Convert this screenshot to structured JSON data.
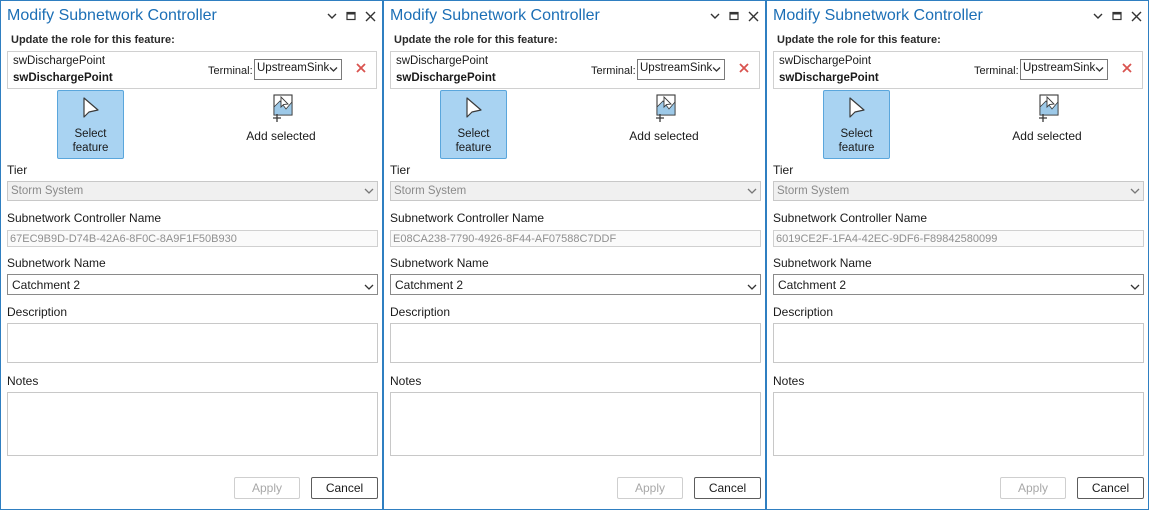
{
  "panes": [
    {
      "title": "Modify Subnetwork Controller",
      "subheading": "Update the role for this feature:",
      "feature": {
        "class": "swDischargePoint",
        "name": "swDischargePoint"
      },
      "terminal_label": "Terminal:",
      "terminal_value": "UpstreamSink",
      "select_feature_label": "Select feature",
      "add_selected_label": "Add selected",
      "tier_label": "Tier",
      "tier_value": "Storm System",
      "controller_name_label": "Subnetwork Controller Name",
      "controller_name_value": "67EC9B9D-D74B-42A6-8F0C-8A9F1F50B930",
      "subnetwork_name_label": "Subnetwork Name",
      "subnetwork_name_value": "Catchment 2",
      "description_label": "Description",
      "description_value": "",
      "notes_label": "Notes",
      "notes_value": "",
      "apply_label": "Apply",
      "cancel_label": "Cancel"
    },
    {
      "title": "Modify Subnetwork Controller",
      "subheading": "Update the role for this feature:",
      "feature": {
        "class": "swDischargePoint",
        "name": "swDischargePoint"
      },
      "terminal_label": "Terminal:",
      "terminal_value": "UpstreamSink",
      "select_feature_label": "Select feature",
      "add_selected_label": "Add selected",
      "tier_label": "Tier",
      "tier_value": "Storm System",
      "controller_name_label": "Subnetwork Controller Name",
      "controller_name_value": "E08CA238-7790-4926-8F44-AF07588C7DDF",
      "subnetwork_name_label": "Subnetwork Name",
      "subnetwork_name_value": "Catchment 2",
      "description_label": "Description",
      "description_value": "",
      "notes_label": "Notes",
      "notes_value": "",
      "apply_label": "Apply",
      "cancel_label": "Cancel"
    },
    {
      "title": "Modify Subnetwork Controller",
      "subheading": "Update the role for this feature:",
      "feature": {
        "class": "swDischargePoint",
        "name": "swDischargePoint"
      },
      "terminal_label": "Terminal:",
      "terminal_value": "UpstreamSink",
      "select_feature_label": "Select feature",
      "add_selected_label": "Add selected",
      "tier_label": "Tier",
      "tier_value": "Storm System",
      "controller_name_label": "Subnetwork Controller Name",
      "controller_name_value": "6019CE2F-1FA4-42EC-9DF6-F89842580099",
      "subnetwork_name_label": "Subnetwork Name",
      "subnetwork_name_value": "Catchment 2",
      "description_label": "Description",
      "description_value": "",
      "notes_label": "Notes",
      "notes_value": "",
      "apply_label": "Apply",
      "cancel_label": "Cancel"
    }
  ],
  "colors": {
    "accent": "#1c6fb6",
    "pane_border": "#2f7fc1",
    "select_button_bg": "#a9d3f2",
    "remove_icon": "#d9534f"
  },
  "icons": {
    "options": "chevron-down-icon",
    "restore": "restore-icon",
    "close": "close-icon",
    "remove": "remove-x-icon",
    "select": "select-cursor-icon",
    "add": "add-selected-icon"
  }
}
